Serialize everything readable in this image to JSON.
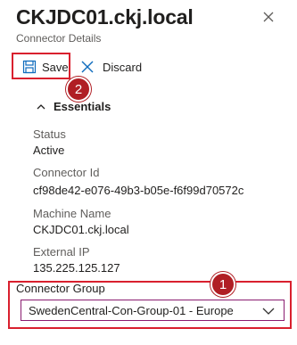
{
  "header": {
    "title": "CKJDC01.ckj.local",
    "subtitle": "Connector Details",
    "close_icon": "close-icon"
  },
  "toolbar": {
    "save_label": "Save",
    "save_icon": "save-icon",
    "discard_label": "Discard",
    "discard_icon": "discard-icon"
  },
  "annotations": {
    "callout_1": "1",
    "callout_2": "2",
    "highlight_color": "#d9202e",
    "callout_color": "#b01e24"
  },
  "essentials": {
    "header_label": "Essentials",
    "fields": [
      {
        "label": "Status",
        "value": "Active"
      },
      {
        "label": "Connector Id",
        "value": "cf98de42-e076-49b3-b05e-f6f99d70572c"
      },
      {
        "label": "Machine Name",
        "value": "CKJDC01.ckj.local"
      },
      {
        "label": "External IP",
        "value": "135.225.125.127"
      }
    ]
  },
  "connector_group": {
    "label": "Connector Group",
    "selected": "SwedenCentral-Con-Group-01 - Europe",
    "accent_color": "#8a1c70"
  }
}
